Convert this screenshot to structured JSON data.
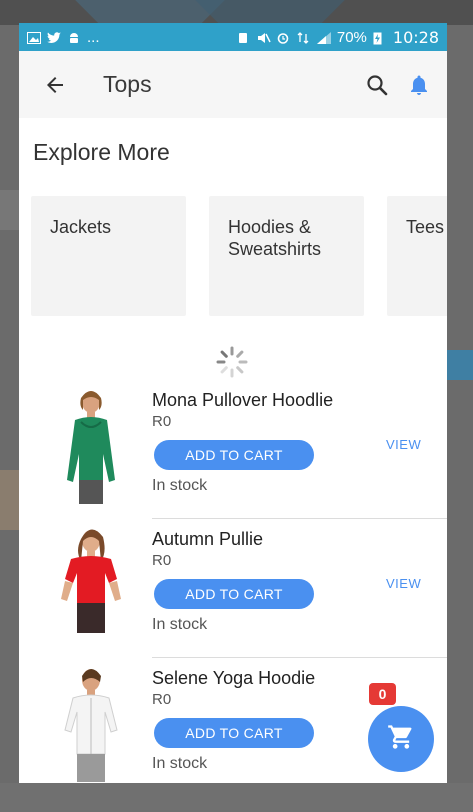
{
  "status_bar": {
    "left_icons": [
      "image-icon",
      "twitter-icon",
      "android-icon"
    ],
    "left_more": "...",
    "battery": "70%",
    "time": "10:28"
  },
  "app_bar": {
    "title": "Tops"
  },
  "explore": {
    "title": "Explore More",
    "categories": [
      {
        "label": "Jackets"
      },
      {
        "label": "Hoodies & Sweatshirts"
      },
      {
        "label": "Tees"
      }
    ]
  },
  "products": [
    {
      "name": "Mona Pullover Hoodlie",
      "price": "R0",
      "add_label": "ADD TO CART",
      "stock": "In stock",
      "view_label": "VIEW",
      "color": "#1f8a5c"
    },
    {
      "name": "Autumn Pullie",
      "price": "R0",
      "add_label": "ADD TO CART",
      "stock": "In stock",
      "view_label": "VIEW",
      "color": "#e31b23"
    },
    {
      "name": "Selene Yoga Hoodie",
      "price": "R0",
      "add_label": "ADD TO CART",
      "stock": "In stock",
      "view_label": "",
      "color": "#f2f2f2"
    }
  ],
  "cart": {
    "count": "0"
  },
  "colors": {
    "accent": "#4a90f0",
    "status_bar": "#2fa1c9",
    "badge": "#e53935"
  }
}
